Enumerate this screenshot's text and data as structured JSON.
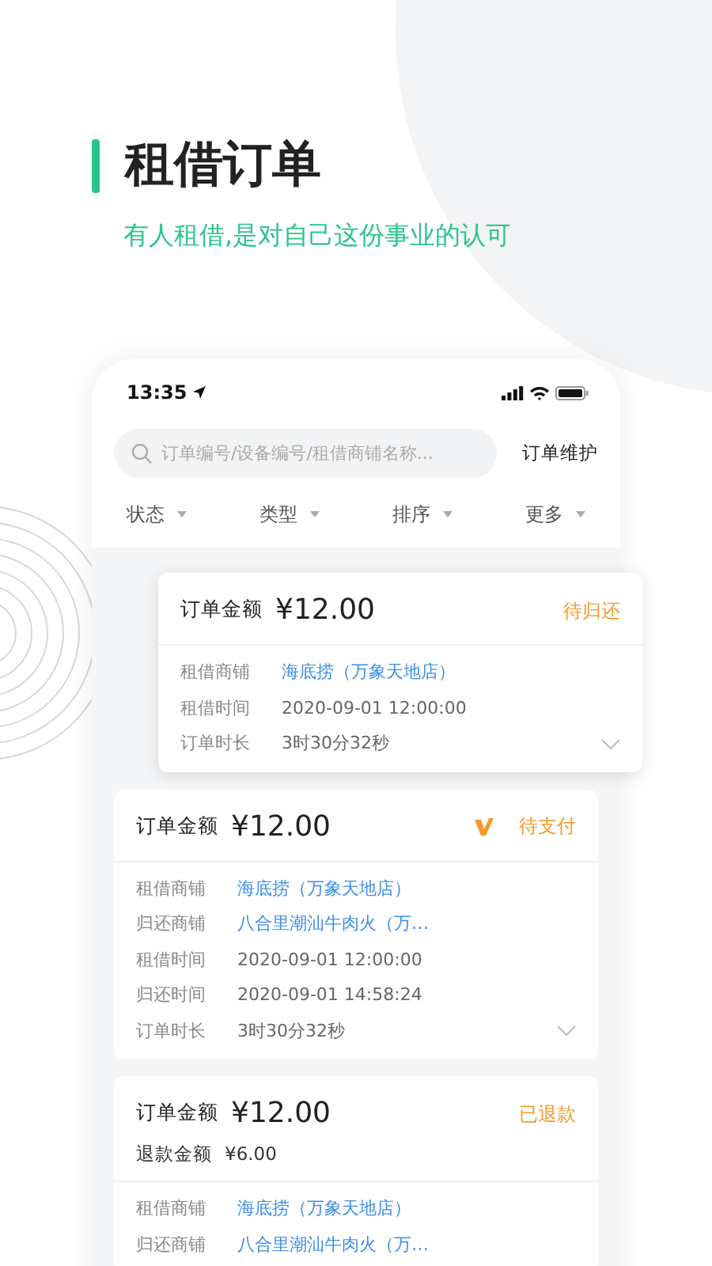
{
  "header": {
    "title": "租借订单",
    "subtitle": "有人租借,是对自己这份事业的认可"
  },
  "phone": {
    "status_bar": {
      "time": "13:35"
    },
    "search": {
      "placeholder": "订单编号/设备编号/租借商铺名称..."
    },
    "action": "订单维护",
    "filters": [
      "状态",
      "类型",
      "排序",
      "更多"
    ],
    "orders": [
      {
        "raised": true,
        "flagged": false,
        "expandable": true,
        "amount_label": "订单金额",
        "amount": "¥12.00",
        "status": "待归还",
        "fields": [
          {
            "label": "租借商铺",
            "value": "海底捞（万象天地店）",
            "link": true
          },
          {
            "label": "租借时间",
            "value": "2020-09-01  12:00:00",
            "link": false
          },
          {
            "label": "订单时长",
            "value": "3时30分32秒",
            "link": false
          }
        ]
      },
      {
        "raised": false,
        "flagged": true,
        "expandable": true,
        "amount_label": "订单金额",
        "amount": "¥12.00",
        "status": "待支付",
        "fields": [
          {
            "label": "租借商铺",
            "value": "海底捞（万象天地店）",
            "link": true
          },
          {
            "label": "归还商铺",
            "value": "八合里潮汕牛肉火（万…",
            "link": true
          },
          {
            "label": "租借时间",
            "value": "2020-09-01  12:00:00",
            "link": false
          },
          {
            "label": "归还时间",
            "value": "2020-09-01  14:58:24",
            "link": false
          },
          {
            "label": "订单时长",
            "value": "3时30分32秒",
            "link": false
          }
        ]
      },
      {
        "raised": false,
        "flagged": false,
        "expandable": false,
        "amount_label": "订单金额",
        "amount": "¥12.00",
        "status": "已退款",
        "extra": [
          {
            "label": "退款金额",
            "value": "¥6.00"
          }
        ],
        "fields": [
          {
            "label": "租借商铺",
            "value": "海底捞（万象天地店）",
            "link": true
          },
          {
            "label": "归还商铺",
            "value": "八合里潮汕牛肉火（万…",
            "link": true
          }
        ]
      }
    ]
  }
}
